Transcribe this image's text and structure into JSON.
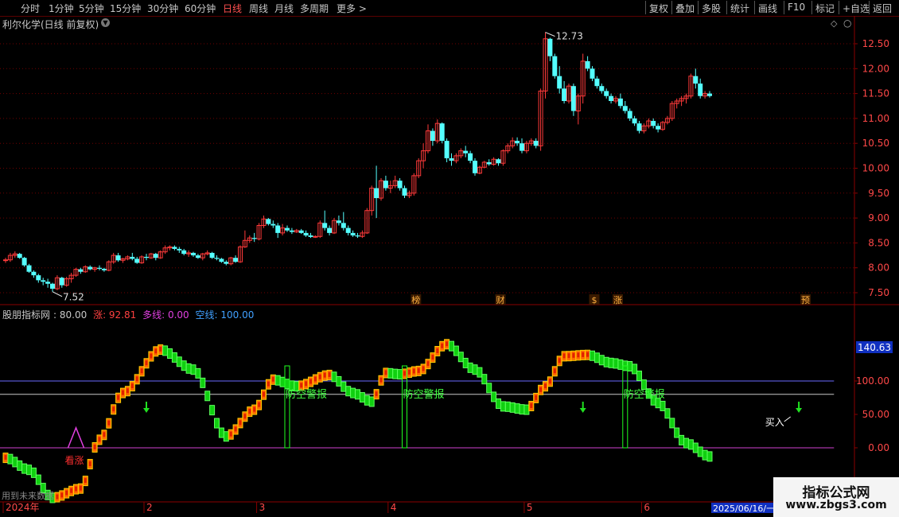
{
  "toolbar": {
    "timeframes": [
      "分时",
      "1分钟",
      "5分钟",
      "15分钟",
      "30分钟",
      "60分钟",
      "日线",
      "周线",
      "月线",
      "多周期",
      "更多 >"
    ],
    "active_timeframe": "日线",
    "right_buttons": [
      "复权",
      "叠加",
      "多股",
      "统计",
      "画线",
      "F10",
      "标记",
      "+自选",
      "返回"
    ]
  },
  "stock_title": "利尔化学(日线 前复权)",
  "indicator_header": {
    "name": "股朋指标网",
    "value1": ": 80.00",
    "zhang_label": "涨: 92.81",
    "duo_label": "多线: 0.00",
    "kong_label": "空线: 100.00"
  },
  "event_markers": [
    {
      "label": "榜",
      "bar": 87
    },
    {
      "label": "财",
      "bar": 105
    },
    {
      "label": "$",
      "bar": 125
    },
    {
      "label": "涨",
      "bar": 130
    },
    {
      "label": "预",
      "bar": 170
    }
  ],
  "annotations": {
    "warning_text": "防空警报",
    "look_up_text": "看涨",
    "buy_text": "买入",
    "future_text": "用到未来数据"
  },
  "date_labels": [
    {
      "text": "2024年",
      "bar": 0
    },
    {
      "text": "2",
      "bar": 30
    },
    {
      "text": "3",
      "bar": 54
    },
    {
      "text": "4",
      "bar": 82
    },
    {
      "text": "5",
      "bar": 111
    },
    {
      "text": "6",
      "bar": 136
    }
  ],
  "current_date_label": "2025/06/16/一",
  "watermark": {
    "line1": "指标公式网",
    "line2": "www.zbgs3.com"
  },
  "chart_data": [
    {
      "type": "candlestick",
      "title": "利尔化学(日线 前复权)",
      "ylim": [
        7.3,
        12.85
      ],
      "yticks": [
        7.5,
        8.0,
        8.5,
        9.0,
        9.5,
        10.0,
        10.5,
        11.0,
        11.5,
        12.0,
        12.5
      ],
      "high_label": "12.73",
      "low_label": "7.52",
      "colors": {
        "up": "#ff3a3a",
        "down": "#54ffff"
      },
      "ohlc": [
        [
          8.15,
          8.2,
          8.1,
          8.16
        ],
        [
          8.16,
          8.3,
          8.12,
          8.25
        ],
        [
          8.25,
          8.33,
          8.2,
          8.28
        ],
        [
          8.28,
          8.3,
          8.18,
          8.2
        ],
        [
          8.2,
          8.22,
          8.02,
          8.05
        ],
        [
          8.05,
          8.08,
          7.9,
          7.92
        ],
        [
          7.92,
          7.95,
          7.8,
          7.85
        ],
        [
          7.85,
          7.88,
          7.7,
          7.75
        ],
        [
          7.75,
          7.8,
          7.65,
          7.72
        ],
        [
          7.72,
          7.78,
          7.6,
          7.68
        ],
        [
          7.68,
          7.7,
          7.52,
          7.58
        ],
        [
          7.58,
          7.85,
          7.55,
          7.8
        ],
        [
          7.8,
          7.82,
          7.6,
          7.65
        ],
        [
          7.65,
          7.82,
          7.62,
          7.78
        ],
        [
          7.78,
          7.9,
          7.7,
          7.85
        ],
        [
          7.85,
          8.0,
          7.82,
          7.97
        ],
        [
          7.97,
          8.0,
          7.88,
          7.92
        ],
        [
          7.92,
          8.05,
          7.9,
          8.02
        ],
        [
          8.02,
          8.05,
          7.95,
          7.97
        ],
        [
          7.97,
          8.02,
          7.92,
          8.0
        ],
        [
          8.0,
          8.05,
          7.95,
          7.98
        ],
        [
          7.98,
          8.0,
          7.92,
          7.95
        ],
        [
          7.95,
          8.15,
          7.93,
          8.12
        ],
        [
          8.12,
          8.3,
          8.08,
          8.25
        ],
        [
          8.25,
          8.3,
          8.12,
          8.15
        ],
        [
          8.15,
          8.2,
          8.1,
          8.18
        ],
        [
          8.18,
          8.25,
          8.15,
          8.22
        ],
        [
          8.22,
          8.3,
          8.15,
          8.18
        ],
        [
          8.18,
          8.22,
          8.08,
          8.1
        ],
        [
          8.1,
          8.25,
          8.08,
          8.22
        ],
        [
          8.22,
          8.28,
          8.15,
          8.2
        ],
        [
          8.2,
          8.3,
          8.18,
          8.28
        ],
        [
          8.28,
          8.3,
          8.15,
          8.2
        ],
        [
          8.2,
          8.35,
          8.18,
          8.32
        ],
        [
          8.32,
          8.45,
          8.28,
          8.4
        ],
        [
          8.4,
          8.45,
          8.35,
          8.42
        ],
        [
          8.42,
          8.45,
          8.35,
          8.38
        ],
        [
          8.38,
          8.42,
          8.3,
          8.35
        ],
        [
          8.35,
          8.38,
          8.25,
          8.28
        ],
        [
          8.28,
          8.35,
          8.22,
          8.3
        ],
        [
          8.3,
          8.32,
          8.22,
          8.25
        ],
        [
          8.25,
          8.28,
          8.18,
          8.2
        ],
        [
          8.2,
          8.3,
          8.15,
          8.28
        ],
        [
          8.28,
          8.35,
          8.25,
          8.3
        ],
        [
          8.3,
          8.32,
          8.18,
          8.2
        ],
        [
          8.2,
          8.25,
          8.15,
          8.18
        ],
        [
          8.18,
          8.2,
          8.1,
          8.12
        ],
        [
          8.12,
          8.15,
          8.05,
          8.08
        ],
        [
          8.08,
          8.22,
          8.05,
          8.2
        ],
        [
          8.2,
          8.25,
          8.1,
          8.12
        ],
        [
          8.12,
          8.45,
          8.1,
          8.42
        ],
        [
          8.42,
          8.75,
          8.4,
          8.55
        ],
        [
          8.55,
          8.65,
          8.5,
          8.6
        ],
        [
          8.6,
          8.7,
          8.52,
          8.58
        ],
        [
          8.58,
          8.9,
          8.55,
          8.85
        ],
        [
          8.85,
          9.05,
          8.8,
          8.98
        ],
        [
          8.98,
          9.0,
          8.85,
          8.88
        ],
        [
          8.88,
          8.95,
          8.8,
          8.85
        ],
        [
          8.85,
          8.9,
          8.6,
          8.7
        ],
        [
          8.7,
          8.88,
          8.65,
          8.8
        ],
        [
          8.8,
          8.85,
          8.72,
          8.75
        ],
        [
          8.75,
          8.8,
          8.68,
          8.72
        ],
        [
          8.72,
          8.78,
          8.7,
          8.75
        ],
        [
          8.75,
          8.78,
          8.68,
          8.7
        ],
        [
          8.7,
          8.75,
          8.62,
          8.65
        ],
        [
          8.65,
          8.7,
          8.6,
          8.62
        ],
        [
          8.62,
          8.65,
          8.6,
          8.63
        ],
        [
          8.63,
          8.95,
          8.6,
          8.9
        ],
        [
          8.9,
          9.15,
          8.75,
          8.8
        ],
        [
          8.8,
          8.85,
          8.65,
          8.7
        ],
        [
          8.7,
          9.0,
          8.68,
          8.95
        ],
        [
          8.95,
          9.05,
          8.85,
          8.9
        ],
        [
          8.9,
          9.12,
          8.75,
          8.8
        ],
        [
          8.8,
          8.85,
          8.65,
          8.7
        ],
        [
          8.7,
          8.75,
          8.62,
          8.65
        ],
        [
          8.65,
          8.7,
          8.6,
          8.63
        ],
        [
          8.63,
          8.75,
          8.6,
          8.7
        ],
        [
          8.7,
          9.2,
          8.68,
          9.15
        ],
        [
          9.15,
          9.65,
          9.05,
          9.6
        ],
        [
          9.6,
          10.05,
          9.0,
          9.4
        ],
        [
          9.4,
          9.8,
          9.35,
          9.75
        ],
        [
          9.75,
          9.85,
          9.55,
          9.6
        ],
        [
          9.6,
          9.75,
          9.5,
          9.65
        ],
        [
          9.65,
          9.85,
          9.6,
          9.75
        ],
        [
          9.75,
          9.8,
          9.55,
          9.6
        ],
        [
          9.6,
          9.65,
          9.4,
          9.45
        ],
        [
          9.45,
          9.55,
          9.4,
          9.5
        ],
        [
          9.5,
          9.9,
          9.45,
          9.85
        ],
        [
          9.85,
          10.2,
          9.8,
          10.15
        ],
        [
          10.15,
          10.5,
          10.0,
          10.35
        ],
        [
          10.35,
          10.88,
          10.3,
          10.75
        ],
        [
          10.75,
          10.8,
          10.45,
          10.55
        ],
        [
          10.55,
          10.98,
          10.5,
          10.9
        ],
        [
          10.9,
          10.92,
          10.5,
          10.55
        ],
        [
          10.55,
          10.6,
          10.12,
          10.2
        ],
        [
          10.2,
          10.3,
          10.05,
          10.15
        ],
        [
          10.15,
          10.3,
          10.1,
          10.25
        ],
        [
          10.25,
          10.4,
          10.2,
          10.35
        ],
        [
          10.35,
          10.45,
          10.22,
          10.3
        ],
        [
          10.3,
          10.35,
          10.1,
          10.15
        ],
        [
          10.15,
          10.2,
          9.85,
          9.9
        ],
        [
          9.9,
          10.05,
          9.88,
          10.02
        ],
        [
          10.02,
          10.15,
          10.0,
          10.12
        ],
        [
          10.12,
          10.18,
          10.05,
          10.08
        ],
        [
          10.08,
          10.22,
          10.05,
          10.18
        ],
        [
          10.18,
          10.2,
          10.05,
          10.1
        ],
        [
          10.1,
          10.38,
          10.05,
          10.35
        ],
        [
          10.35,
          10.5,
          10.3,
          10.45
        ],
        [
          10.45,
          10.62,
          10.4,
          10.55
        ],
        [
          10.55,
          10.62,
          10.45,
          10.5
        ],
        [
          10.5,
          10.6,
          10.3,
          10.35
        ],
        [
          10.35,
          10.55,
          10.3,
          10.5
        ],
        [
          10.5,
          10.6,
          10.45,
          10.55
        ],
        [
          10.55,
          10.6,
          10.4,
          10.45
        ],
        [
          10.45,
          11.6,
          10.35,
          11.55
        ],
        [
          11.55,
          12.73,
          11.4,
          12.6
        ],
        [
          12.6,
          12.62,
          12.15,
          12.25
        ],
        [
          12.25,
          12.3,
          11.8,
          11.85
        ],
        [
          11.85,
          12.05,
          11.5,
          11.6
        ],
        [
          11.6,
          11.75,
          11.3,
          11.35
        ],
        [
          11.35,
          11.7,
          11.3,
          11.65
        ],
        [
          11.65,
          11.7,
          11.05,
          11.15
        ],
        [
          11.15,
          11.5,
          10.88,
          11.45
        ],
        [
          11.45,
          12.3,
          11.3,
          12.15
        ],
        [
          12.15,
          12.25,
          11.95,
          12.0
        ],
        [
          12.0,
          12.05,
          11.75,
          11.8
        ],
        [
          11.8,
          11.85,
          11.6,
          11.65
        ],
        [
          11.65,
          11.7,
          11.5,
          11.55
        ],
        [
          11.55,
          11.6,
          11.4,
          11.45
        ],
        [
          11.45,
          11.5,
          11.3,
          11.35
        ],
        [
          11.35,
          11.45,
          11.3,
          11.4
        ],
        [
          11.4,
          11.5,
          11.2,
          11.25
        ],
        [
          11.25,
          11.35,
          11.1,
          11.15
        ],
        [
          11.15,
          11.2,
          10.95,
          11.0
        ],
        [
          11.0,
          11.05,
          10.85,
          10.9
        ],
        [
          10.9,
          10.95,
          10.7,
          10.75
        ],
        [
          10.75,
          10.9,
          10.7,
          10.85
        ],
        [
          10.85,
          11.0,
          10.8,
          10.95
        ],
        [
          10.95,
          11.0,
          10.8,
          10.85
        ],
        [
          10.85,
          10.9,
          10.72,
          10.78
        ],
        [
          10.78,
          10.95,
          10.75,
          10.92
        ],
        [
          10.92,
          11.05,
          10.88,
          11.0
        ],
        [
          11.0,
          11.35,
          10.95,
          11.3
        ],
        [
          11.3,
          11.4,
          11.2,
          11.35
        ],
        [
          11.35,
          11.45,
          11.25,
          11.4
        ],
        [
          11.4,
          11.5,
          11.3,
          11.45
        ],
        [
          11.45,
          11.9,
          11.4,
          11.85
        ],
        [
          11.85,
          12.0,
          11.6,
          11.7
        ],
        [
          11.7,
          11.8,
          11.4,
          11.45
        ],
        [
          11.45,
          11.55,
          11.4,
          11.5
        ],
        [
          11.5,
          11.55,
          11.42,
          11.45
        ]
      ]
    },
    {
      "type": "line",
      "title": "股朋指标网",
      "ylim": [
        -75,
        185
      ],
      "yticks": [
        0.0,
        50.0,
        100.0
      ],
      "current_value_label": "140.63",
      "reference_lines": [
        {
          "value": 100,
          "color": "#6a6aff"
        },
        {
          "value": 80,
          "color": "#c8c8c8"
        },
        {
          "value": 0,
          "color": "#d040d0"
        }
      ],
      "x": [
        0,
        5,
        10,
        16,
        20,
        25,
        33,
        40,
        47,
        53,
        57,
        62,
        69,
        74,
        78,
        81,
        84,
        88,
        94,
        100,
        106,
        111,
        115,
        119,
        124,
        129,
        133,
        139,
        145,
        150,
        155,
        160,
        170,
        172
      ],
      "values": [
        -12,
        -30,
        -72,
        -58,
        15,
        85,
        150,
        120,
        20,
        60,
        105,
        95,
        112,
        85,
        72,
        115,
        113,
        118,
        158,
        120,
        65,
        60,
        95,
        140,
        142,
        130,
        125,
        70,
        10,
        -10,
        0,
        70,
        90,
        88
      ],
      "series_colors": {
        "rising": "#ff6a00",
        "falling": "#10d010"
      },
      "warning_bars": [
        60,
        85,
        132
      ],
      "down_arrows": [
        30,
        123,
        169
      ],
      "spike_bar": 15
    }
  ]
}
